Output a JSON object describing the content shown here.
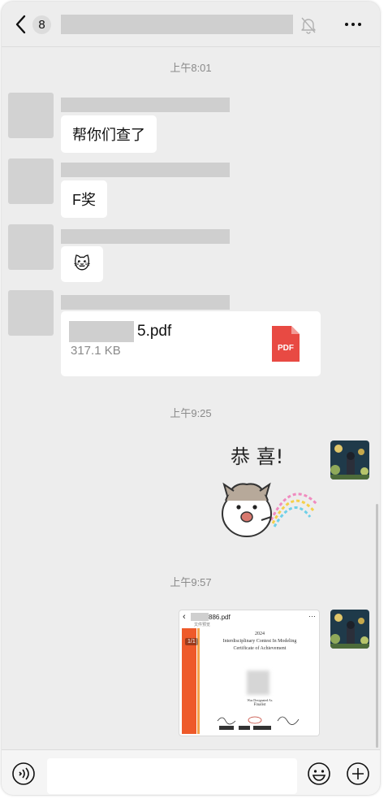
{
  "header": {
    "unread_count": "8"
  },
  "timestamps": [
    "上午8:01",
    "上午9:25",
    "上午9:57"
  ],
  "messages": [
    {
      "text": "帮你们查了"
    },
    {
      "text": "F奖"
    },
    {
      "emoji": "🐱"
    },
    {
      "file_name_visible": "5.pdf",
      "file_size": "317.1 KB",
      "file_icon_label": "PDF"
    }
  ],
  "sticker": {
    "caption": "恭 喜!"
  },
  "preview": {
    "file_name_visible": "886.pdf",
    "subtitle": "文件预览",
    "page_indicator": "1/1",
    "lines": [
      "2024",
      "Interdisciplinary Contest In Modeling",
      "Certificate of Achievement",
      "Was Designated As",
      "Finalist"
    ]
  },
  "input": {
    "value": ""
  },
  "colors": {
    "chat_bg": "#ededed",
    "bubble": "#ffffff",
    "pdf_red": "#e84a43",
    "cert_orange": "#ee5a2a"
  },
  "icons": [
    "back-icon",
    "mute-icon",
    "more-icon",
    "pdf-icon",
    "voice-icon",
    "emoji-icon",
    "plus-icon"
  ]
}
